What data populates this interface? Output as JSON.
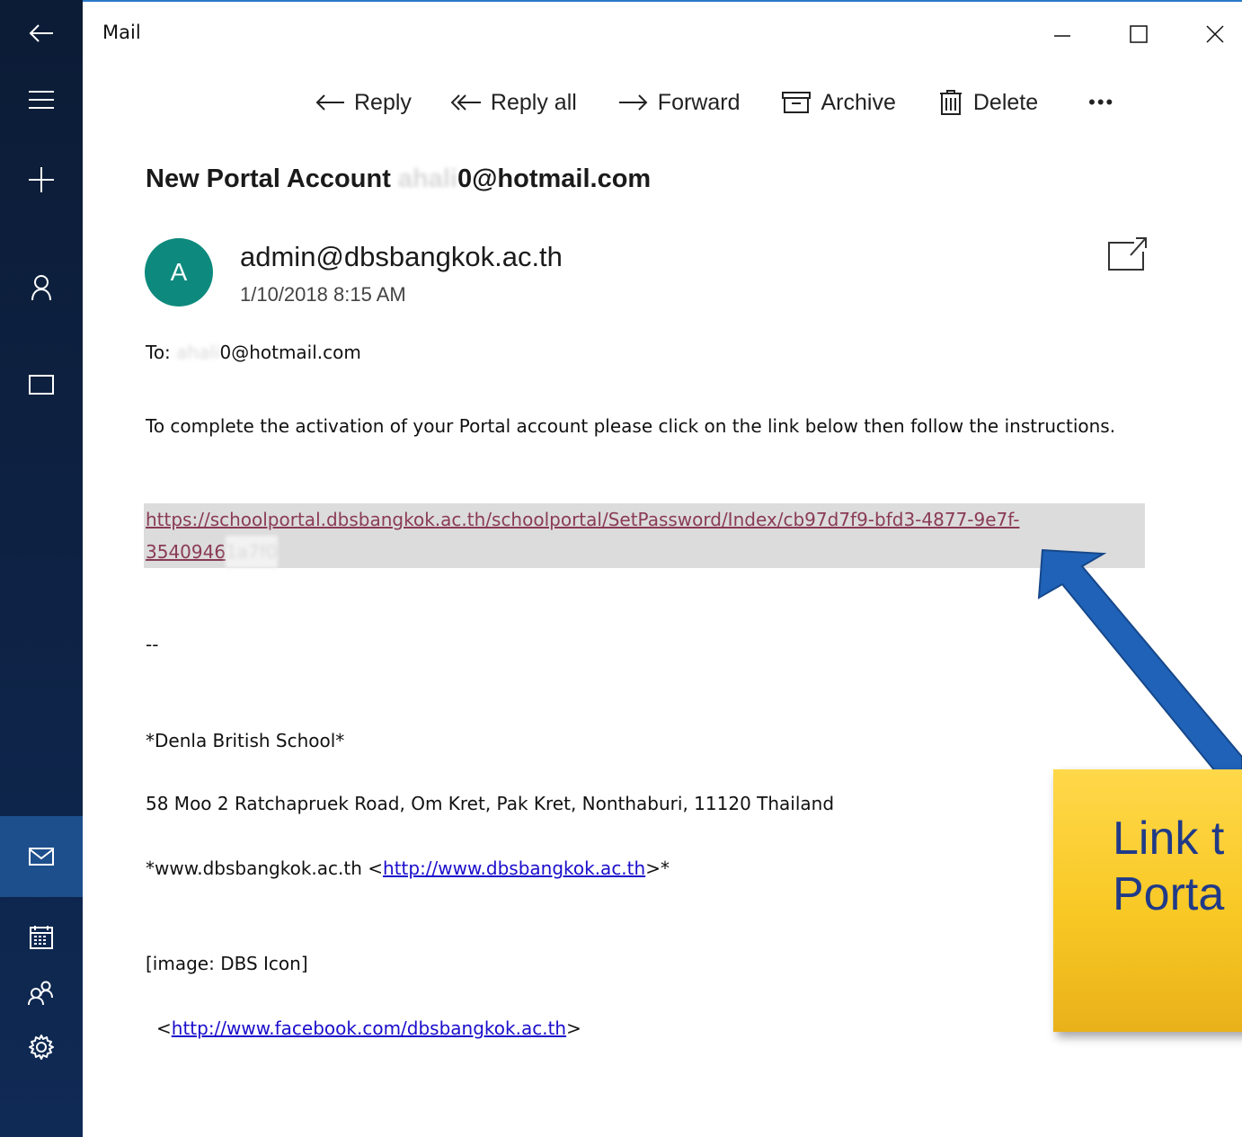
{
  "app": {
    "title": "Mail"
  },
  "rail": {
    "items": [
      {
        "icon": "back-arrow-icon"
      },
      {
        "icon": "hamburger-menu-icon"
      },
      {
        "icon": "new-mail-plus-icon"
      },
      {
        "icon": "account-person-icon"
      },
      {
        "icon": "folder-icon"
      },
      {
        "icon": "mail-envelope-icon",
        "active": true
      },
      {
        "icon": "calendar-icon"
      },
      {
        "icon": "people-icon"
      },
      {
        "icon": "settings-gear-icon"
      }
    ]
  },
  "window_controls": [
    "minimize-icon",
    "maximize-icon",
    "close-icon"
  ],
  "toolbar": {
    "reply": "Reply",
    "reply_all": "Reply all",
    "forward": "Forward",
    "archive": "Archive",
    "delete": "Delete",
    "more": "•••"
  },
  "message": {
    "subject_prefix": "New Portal Account",
    "subject_email_hidden": "ahali",
    "subject_email_visible": "0@hotmail.com",
    "avatar_letter": "A",
    "sender": "admin@dbsbangkok.ac.th",
    "date": "1/10/2018 8:15 AM",
    "to_label": "To:",
    "to_hidden": "ahali",
    "to_visible": "0@hotmail.com",
    "body": {
      "instructions": "To complete the activation of your Portal account please click on the link below then follow the instructions.",
      "link_line1": "https://schoolportal.dbsbangkok.ac.th/schoolportal/SetPassword/Index/cb97d7f9-bfd3-4877-9e7f-",
      "link_line2": "3540946",
      "link_hidden": "1a7f0",
      "separator": "--",
      "school": "*Denla British School*",
      "address": "58 Moo 2 Ratchapruek Road, Om Kret, Pak Kret, Nonthaburi, 11120 Thailand",
      "website_prefix": "*www.dbsbangkok.ac.th <",
      "website_link": "http://www.dbsbangkok.ac.th",
      "website_suffix": ">*",
      "image_placeholder": "[image: DBS Icon]",
      "facebook_prefix": "<",
      "facebook_link": "http://www.facebook.com/dbsbangkok.ac.th",
      "facebook_suffix": ">"
    }
  },
  "callout": {
    "text": "Link t\nPorta",
    "color": "#f8c824",
    "arrow_color": "#1f62b8"
  }
}
